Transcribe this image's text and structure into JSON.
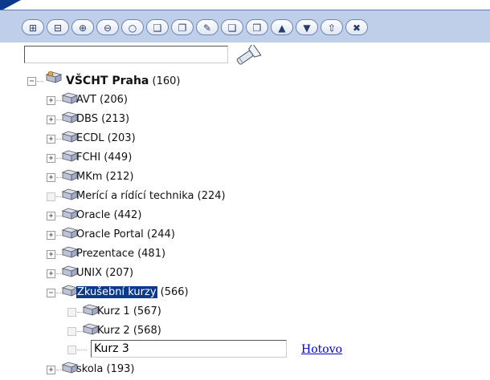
{
  "toolbar": {
    "buttons": [
      {
        "name": "expand-all-icon",
        "glyph": "⊞"
      },
      {
        "name": "collapse-all-icon",
        "glyph": "⊟"
      },
      {
        "name": "zoom-in-icon",
        "glyph": "⊕"
      },
      {
        "name": "zoom-out-icon",
        "glyph": "⊖"
      },
      {
        "name": "search-icon",
        "glyph": "○"
      },
      {
        "name": "folder-open-icon",
        "glyph": "❑"
      },
      {
        "name": "folder-add-icon",
        "glyph": "❐"
      },
      {
        "name": "edit-pencil-icon",
        "glyph": "✎"
      },
      {
        "name": "copy-icon",
        "glyph": "❏"
      },
      {
        "name": "paste-icon",
        "glyph": "❒"
      },
      {
        "name": "move-up-icon",
        "glyph": "▲"
      },
      {
        "name": "move-down-icon",
        "glyph": "▼"
      },
      {
        "name": "move-top-icon",
        "glyph": "⇧"
      },
      {
        "name": "delete-icon",
        "glyph": "✖"
      }
    ]
  },
  "search": {
    "value": "",
    "placeholder": ""
  },
  "tree": {
    "root": {
      "label": "VŠCHT Praha",
      "count": "(160)"
    },
    "items": [
      {
        "label": "AVT",
        "count": "(206)"
      },
      {
        "label": "DBS",
        "count": "(213)"
      },
      {
        "label": "ECDL",
        "count": "(203)"
      },
      {
        "label": "FCHI",
        "count": "(449)"
      },
      {
        "label": "MKm",
        "count": "(212)"
      },
      {
        "label": "Merící a rídící technika",
        "count": "(224)"
      },
      {
        "label": "Oracle",
        "count": "(442)"
      },
      {
        "label": "Oracle Portal",
        "count": "(244)"
      },
      {
        "label": "Prezentace",
        "count": "(481)"
      },
      {
        "label": "UNIX",
        "count": "(207)"
      },
      {
        "label": "Zkušební kurzy",
        "count": "(566)"
      }
    ],
    "children": [
      {
        "label": "Kurz 1",
        "count": "(567)"
      },
      {
        "label": "Kurz 2",
        "count": "(568)"
      }
    ],
    "edit_value": "Kurz 3",
    "done_label": "Hotovo",
    "last_partial": {
      "label": "skola",
      "count": "(193)"
    }
  },
  "colors": {
    "toolbar_bg": "#bfcfe9",
    "selection": "#0a3a8c",
    "link": "#0000cc"
  }
}
